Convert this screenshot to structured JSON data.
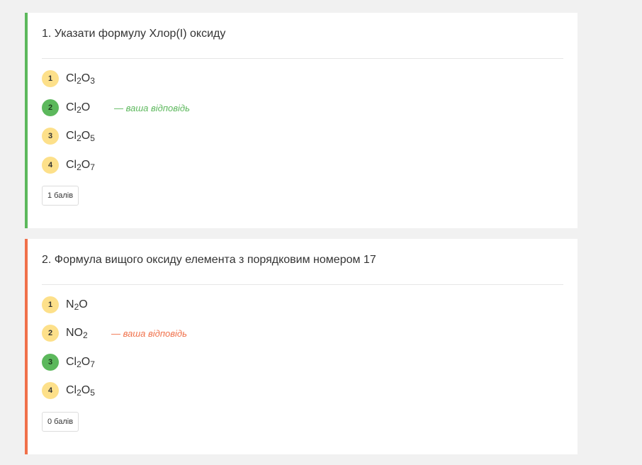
{
  "questions": [
    {
      "title": "1. Указати формулу Хлор(І) оксиду",
      "status": "correct",
      "options": [
        {
          "num": "1",
          "parts": [
            [
              "Cl",
              ""
            ],
            [
              "2",
              "sub"
            ],
            [
              "O",
              ""
            ],
            [
              "3",
              "sub"
            ]
          ],
          "correct": false
        },
        {
          "num": "2",
          "parts": [
            [
              "Cl",
              ""
            ],
            [
              "2",
              "sub"
            ],
            [
              "O",
              ""
            ]
          ],
          "correct": true,
          "your_answer": "— ваша відповідь"
        },
        {
          "num": "3",
          "parts": [
            [
              "Cl",
              ""
            ],
            [
              "2",
              "sub"
            ],
            [
              "O",
              ""
            ],
            [
              "5",
              "sub"
            ]
          ],
          "correct": false
        },
        {
          "num": "4",
          "parts": [
            [
              "Cl",
              ""
            ],
            [
              "2",
              "sub"
            ],
            [
              "O",
              ""
            ],
            [
              "7",
              "sub"
            ]
          ],
          "correct": false
        }
      ],
      "score": "1 балів"
    },
    {
      "title": "2. Формула вищого оксиду елемента з порядковим номером 17",
      "status": "wrong",
      "options": [
        {
          "num": "1",
          "parts": [
            [
              "N",
              ""
            ],
            [
              "2",
              "sub"
            ],
            [
              "O",
              ""
            ]
          ],
          "correct": false
        },
        {
          "num": "2",
          "parts": [
            [
              "NO",
              ""
            ],
            [
              "2",
              "sub"
            ]
          ],
          "correct": false,
          "your_answer": "— ваша відповідь"
        },
        {
          "num": "3",
          "parts": [
            [
              "Cl",
              ""
            ],
            [
              "2",
              "sub"
            ],
            [
              "O",
              ""
            ],
            [
              "7",
              "sub"
            ]
          ],
          "correct": true
        },
        {
          "num": "4",
          "parts": [
            [
              "Cl",
              ""
            ],
            [
              "2",
              "sub"
            ],
            [
              "O",
              ""
            ],
            [
              "5",
              "sub"
            ]
          ],
          "correct": false
        }
      ],
      "score": "0 балів"
    }
  ],
  "colors": {
    "correct_accent": "#5cb85c",
    "wrong_accent": "#f0704a",
    "option_badge": "#fde08a",
    "background": "#f1f1f1"
  }
}
